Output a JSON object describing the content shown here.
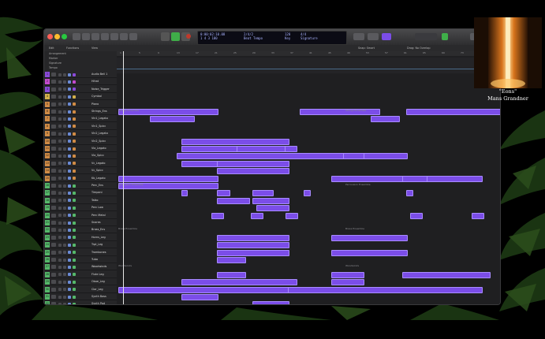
{
  "window": {
    "lcd": {
      "l1a": "0:00:02:10.08",
      "l1b": "2/4/2",
      "l2a": "1 4 3  100",
      "l2b": "Beat Tempo",
      "l3a": "Key",
      "l3b": "Signature",
      "l3c": "120",
      "l3d": "4/4"
    },
    "subbar": [
      "Edit",
      "Functions",
      "View"
    ],
    "subbar_right": [
      "Snap: Smart",
      "Drag: No Overlap"
    ],
    "globals": [
      "Arrangement",
      "Marker",
      "Signature",
      "Tempo"
    ],
    "tracks": [
      {
        "n": "1",
        "name": "Audio Bell 1",
        "color": "#8a4ad9"
      },
      {
        "n": "2",
        "name": "Hihat",
        "color": "#c44acd"
      },
      {
        "n": "3",
        "name": "Noise_Trigger",
        "color": "#8a4ad9"
      },
      {
        "n": "4",
        "name": "Cymbal",
        "color": "#d3b04a"
      },
      {
        "n": "5",
        "name": "Piano",
        "color": "#d08b45"
      },
      {
        "n": "6",
        "name": "Strings_Ens",
        "color": "#d08b45"
      },
      {
        "n": "7",
        "name": "Vln1_Legato",
        "color": "#d08b45"
      },
      {
        "n": "8",
        "name": "Vln1_Spicc",
        "color": "#d08b45"
      },
      {
        "n": "9",
        "name": "Vln2_Legato",
        "color": "#d08b45"
      },
      {
        "n": "10",
        "name": "Vln2_Spicc",
        "color": "#d08b45"
      },
      {
        "n": "11",
        "name": "Vla_Legato",
        "color": "#d08b45"
      },
      {
        "n": "12",
        "name": "Vla_Spicc",
        "color": "#d08b45"
      },
      {
        "n": "13",
        "name": "Vc_Legato",
        "color": "#d08b45"
      },
      {
        "n": "14",
        "name": "Vc_Spicc",
        "color": "#d08b45"
      },
      {
        "n": "15",
        "name": "Kb_Legato",
        "color": "#d08b45"
      },
      {
        "n": "16",
        "name": "Perc_Ens",
        "color": "#55b86a"
      },
      {
        "n": "17",
        "name": "Timpani",
        "color": "#55b86a"
      },
      {
        "n": "18",
        "name": "Taiko",
        "color": "#55b86a"
      },
      {
        "n": "19",
        "name": "Perc Low",
        "color": "#55b86a"
      },
      {
        "n": "20",
        "name": "Perc Metal",
        "color": "#55b86a"
      },
      {
        "n": "21",
        "name": "Snares",
        "color": "#55b86a"
      },
      {
        "n": "22",
        "name": "Brass_Ens",
        "color": "#55b86a"
      },
      {
        "n": "23",
        "name": "Horns_Leg",
        "color": "#55b86a"
      },
      {
        "n": "24",
        "name": "Trpt_Leg",
        "color": "#55b86a"
      },
      {
        "n": "25",
        "name": "Trombones",
        "color": "#55b86a"
      },
      {
        "n": "26",
        "name": "Tuba",
        "color": "#55b86a"
      },
      {
        "n": "27",
        "name": "Woodwinds",
        "color": "#55b86a"
      },
      {
        "n": "28",
        "name": "Flute Leg",
        "color": "#55b86a"
      },
      {
        "n": "29",
        "name": "Oboe_Leg",
        "color": "#55b86a"
      },
      {
        "n": "30",
        "name": "Clar_Leg",
        "color": "#55b86a"
      },
      {
        "n": "31",
        "name": "Synth Bass",
        "color": "#55b86a"
      },
      {
        "n": "32",
        "name": "Synth Pad",
        "color": "#55b86a"
      },
      {
        "n": "33",
        "name": "Synth Lead",
        "color": "#55b86a"
      }
    ],
    "ruler": [
      "1",
      "5",
      "9",
      "13",
      "17",
      "21",
      "25",
      "29",
      "33",
      "37",
      "41",
      "45",
      "49",
      "53",
      "57",
      "61",
      "65",
      "69",
      "73",
      "77"
    ],
    "lane_labels": [
      {
        "text": "Strings Ensemble",
        "lane": 5
      },
      {
        "text": "Strings Ensemble",
        "lane": 5,
        "right": true
      },
      {
        "text": "Percussion Ensemble",
        "lane": 15
      },
      {
        "text": "Percussion Ensemble",
        "lane": 15,
        "right": true
      },
      {
        "text": "Brass Ensemble",
        "lane": 21
      },
      {
        "text": "Brass Ensemble",
        "lane": 21,
        "right": true
      },
      {
        "text": "Woodwinds",
        "lane": 26
      },
      {
        "text": "Woodwinds",
        "lane": 26,
        "right": true
      }
    ]
  },
  "overlay": {
    "caption_line1": "\"Eons\"",
    "caption_line2": "Mans Grandner"
  }
}
